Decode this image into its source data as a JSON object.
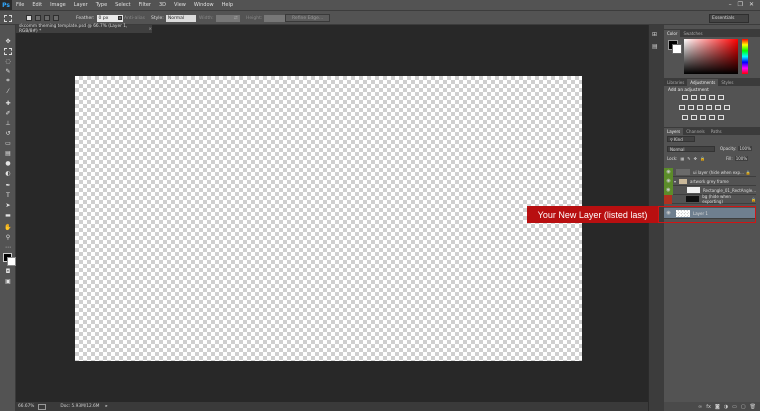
{
  "app": {
    "logo": "Ps"
  },
  "menu": [
    "File",
    "Edit",
    "Image",
    "Layer",
    "Type",
    "Select",
    "Filter",
    "3D",
    "View",
    "Window",
    "Help"
  ],
  "options": {
    "feather_label": "Feather:",
    "feather_value": "0 px",
    "antialias_label": "Anti-alias",
    "style_label": "Style:",
    "style_value": "Normal",
    "width_label": "Width:",
    "height_label": "Height:",
    "refine_edge": "Refine Edge..."
  },
  "workspace": "Essentials",
  "document": {
    "tab_title": "skcomm theming template.psd @ 66.7% (Layer 1, RGB/8#) *",
    "zoom": "66.67%",
    "doc_info": "Doc: 5.93M/12.6M"
  },
  "panels": {
    "color_tabs": [
      "Color",
      "Swatches"
    ],
    "adj_tabs": [
      "Libraries",
      "Adjustments",
      "Styles"
    ],
    "adj_heading": "Add an adjustment",
    "layer_tabs": [
      "Layers",
      "Channels",
      "Paths"
    ],
    "kind": "Kind",
    "blend_mode": "Normal",
    "opacity_label": "Opacity:",
    "opacity_value": "100%",
    "lock_label": "Lock:",
    "fill_label": "Fill:",
    "fill_value": "100%",
    "layers": [
      {
        "name": "ui layer (hide when exp...",
        "thumb": "#6a6a6a",
        "eye": "#6c9e2f"
      },
      {
        "name": "artwork grey frame",
        "thumb": "#c9b89a",
        "eye": "#6c9e2f",
        "group": true
      },
      {
        "name": "Rectangle_01_RectAngle...",
        "thumb": "#f0f0f0",
        "eye": "#6c9e2f"
      },
      {
        "name": "bg (hide when exporting)",
        "thumb": "#111111",
        "eye": "#c0392b"
      },
      {
        "name": "Layer 1",
        "thumb": "#e6e6e6",
        "eye": "#ffffff",
        "selected": true
      }
    ]
  },
  "callout": {
    "text": "Your New Layer (listed last)",
    "color": "#b80f10"
  }
}
